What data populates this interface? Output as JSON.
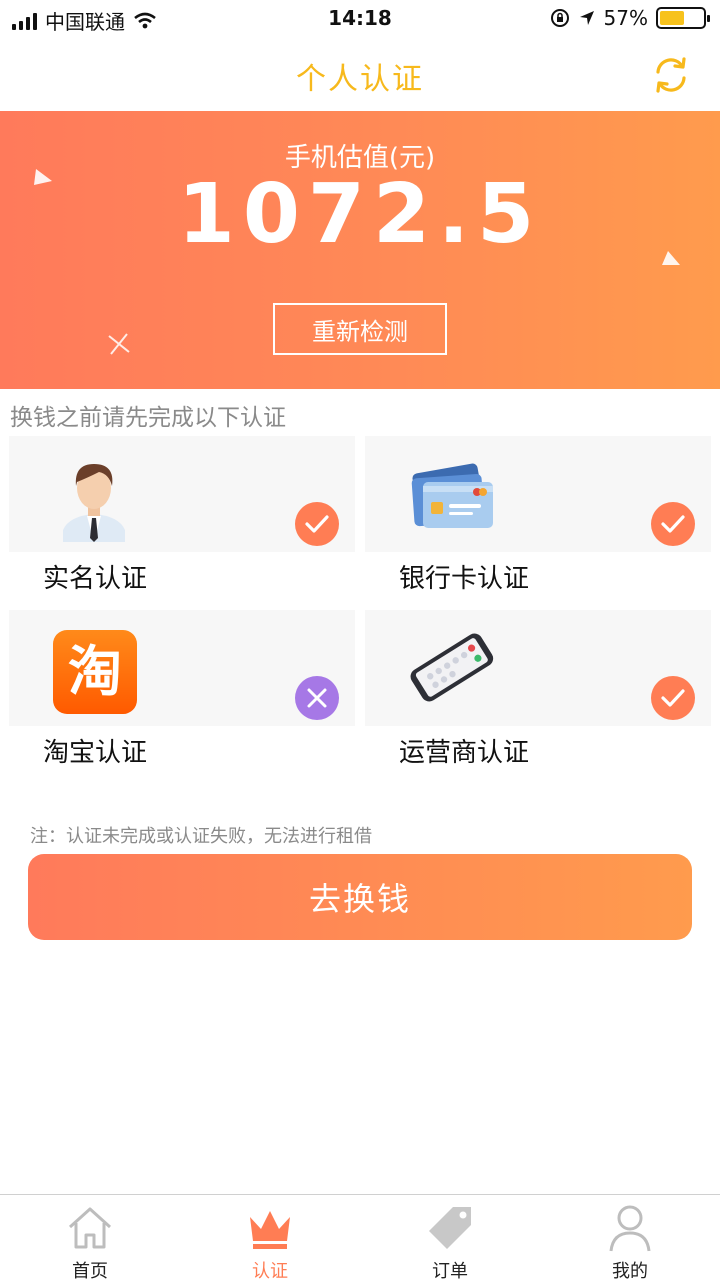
{
  "status_bar": {
    "carrier": "中国联通",
    "time": "14:18",
    "battery_pct": "57%",
    "battery_level": 0.57
  },
  "header": {
    "title": "个人认证"
  },
  "banner": {
    "label": "手机估值(元)",
    "value": "1072.5",
    "recheck_label": "重新检测"
  },
  "section_title": "换钱之前请先完成以下认证",
  "cards": [
    {
      "label": "实名认证",
      "icon": "person-icon",
      "status": "done"
    },
    {
      "label": "银行卡认证",
      "icon": "bank-card-icon",
      "status": "done"
    },
    {
      "label": "淘宝认证",
      "icon": "taobao-icon",
      "status": "failed",
      "icon_text": "淘"
    },
    {
      "label": "运营商认证",
      "icon": "phone-icon",
      "status": "done"
    }
  ],
  "note": "注：认证未完成或认证失败，无法进行租借",
  "cta_label": "去换钱",
  "tabs": [
    {
      "label": "首页",
      "icon": "home-icon",
      "active": false
    },
    {
      "label": "认证",
      "icon": "crown-icon",
      "active": true
    },
    {
      "label": "订单",
      "icon": "tag-icon",
      "active": false
    },
    {
      "label": "我的",
      "icon": "user-icon",
      "active": false
    }
  ],
  "colors": {
    "accent": "#ff7d54",
    "title_yellow": "#f7b91c",
    "fail_purple": "#a678e6",
    "banner_start": "#ff7a5b",
    "banner_end": "#ff9b4d"
  }
}
